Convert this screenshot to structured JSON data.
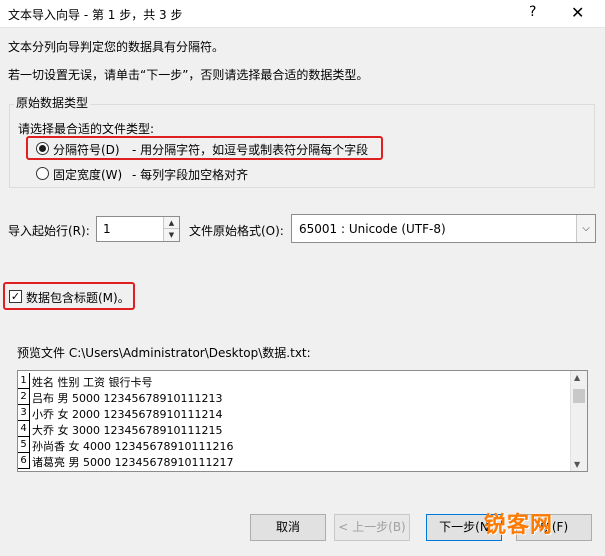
{
  "window": {
    "title": "文本导入向导 - 第 1 步，共 3 步",
    "help_glyph": "?",
    "close_glyph": "✕"
  },
  "intro": {
    "line1": "文本分列向导判定您的数据具有分隔符。",
    "line2": "若一切设置无误，请单击“下一步”，否则请选择最合适的数据类型。"
  },
  "original_type": {
    "legend": "原始数据类型",
    "prompt": "请选择最合适的文件类型:",
    "options": [
      {
        "label": "分隔符号(D)",
        "desc": "- 用分隔字符，如逗号或制表符分隔每个字段",
        "checked": true
      },
      {
        "label": "固定宽度(W)",
        "desc": "- 每列字段加空格对齐",
        "checked": false
      }
    ]
  },
  "start_row": {
    "label": "导入起始行(R):",
    "value": "1"
  },
  "file_origin": {
    "label": "文件原始格式(O):",
    "value": "65001 : Unicode (UTF-8)"
  },
  "headers_checkbox": {
    "label": "数据包含标题(M)。",
    "checked": true,
    "check_glyph": "✓"
  },
  "preview": {
    "label": "预览文件 C:\\Users\\Administrator\\Desktop\\数据.txt:",
    "rows": [
      {
        "num": "1",
        "text": "姓名 性别 工资 银行卡号"
      },
      {
        "num": "2",
        "text": "吕布 男 5000 12345678910111213"
      },
      {
        "num": "3",
        "text": "小乔 女 2000 12345678910111214"
      },
      {
        "num": "4",
        "text": "大乔 女 3000 12345678910111215"
      },
      {
        "num": "5",
        "text": "孙尚香 女 4000 12345678910111216"
      },
      {
        "num": "6",
        "text": "诸葛亮 男 5000 12345678910111217"
      }
    ]
  },
  "buttons": {
    "cancel": "取消",
    "back": "< 上一步(B)",
    "next": "下一步(N",
    "finish": "成(F)"
  },
  "watermark": "锐客网",
  "colors": {
    "highlight_red": "#e02020",
    "watermark_orange": "#ff7a00"
  }
}
